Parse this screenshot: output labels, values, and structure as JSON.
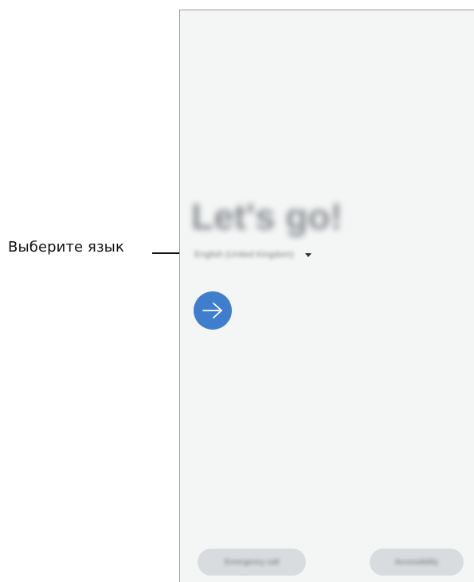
{
  "annotation": {
    "label": "Выберите язык"
  },
  "screen": {
    "title": "Let's go!",
    "language": {
      "selected": "English (United Kingdom)",
      "icon": "dropdown-arrow-icon"
    },
    "next_button": {
      "icon": "arrow-right-icon",
      "color": "#3f7ecc"
    },
    "bottom_buttons": {
      "emergency_call": "Emergency call",
      "accessibility": "Accessibility"
    },
    "background_color": "#f4f6f6"
  }
}
